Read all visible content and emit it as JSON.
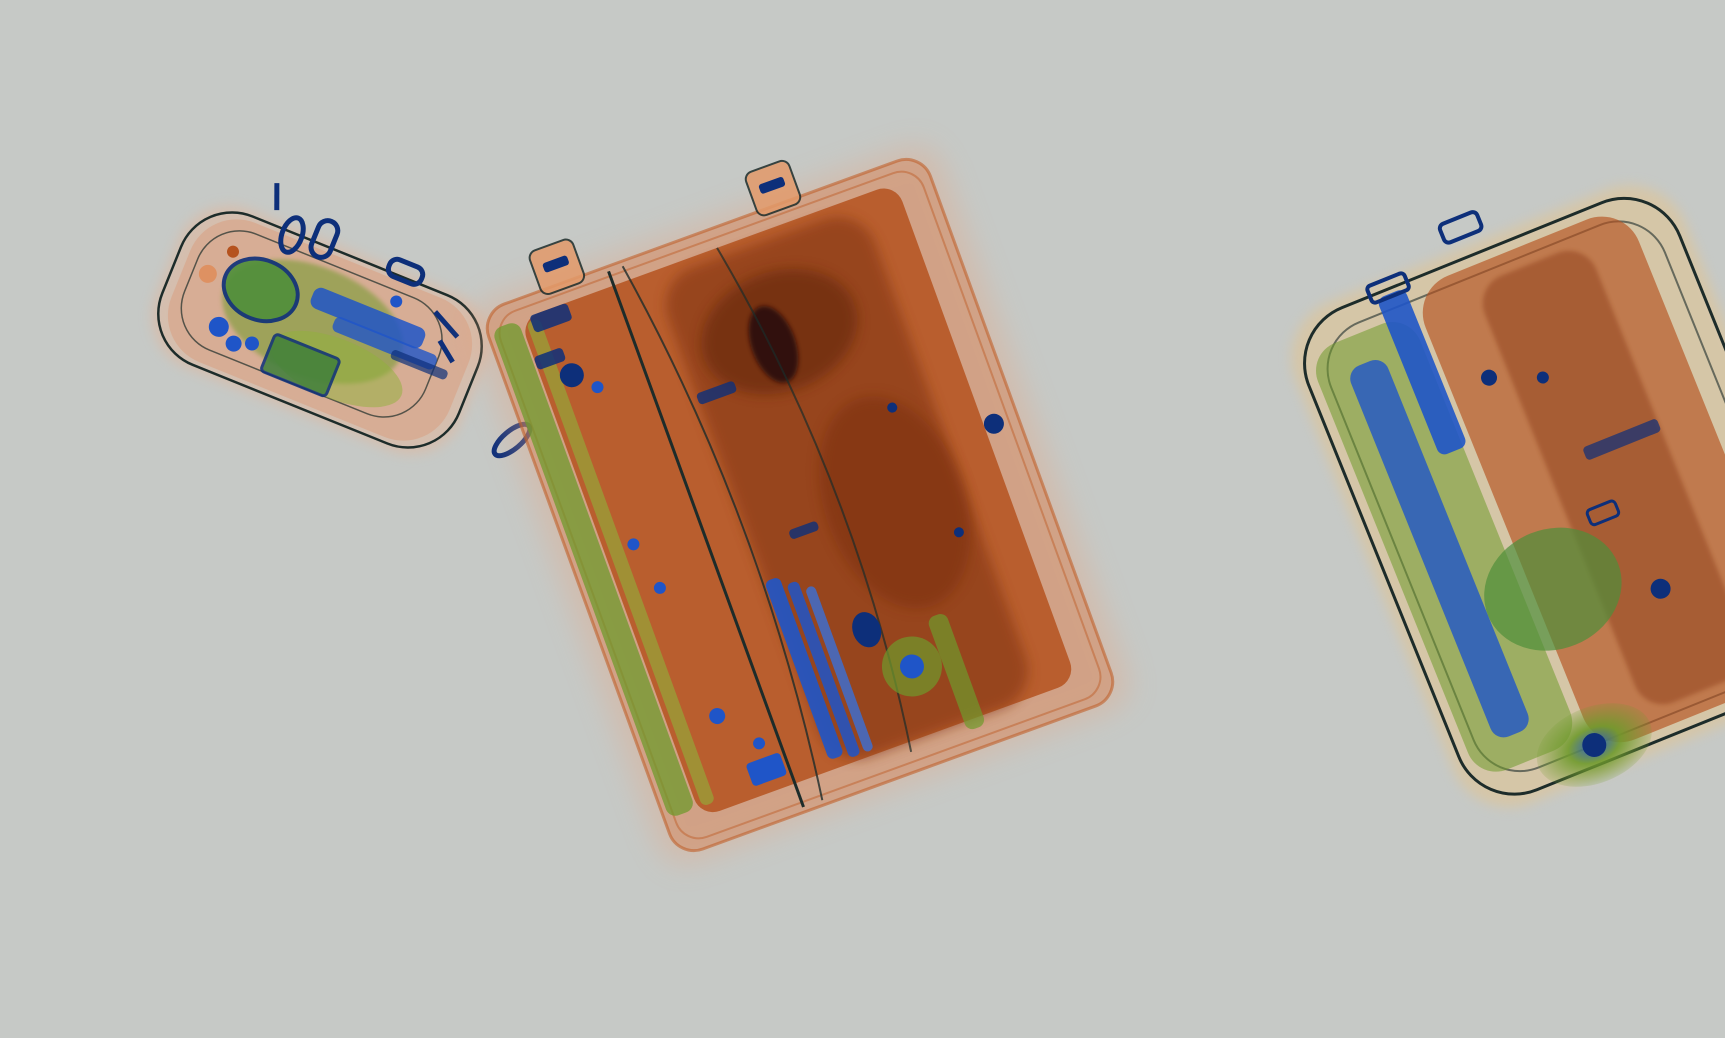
{
  "image": {
    "kind": "x-ray baggage scan",
    "background_color": "#c6c9c6",
    "palette": {
      "organic": "#b5521e",
      "organic_dark": "#7a2e10",
      "mixed": "#6f9a2c",
      "metal": "#1f55c8",
      "metal_dark": "#0d2f7a",
      "dense": "#2a0d0d",
      "outline": "#1d2c2a"
    }
  },
  "objects": [
    {
      "name": "small-bag",
      "material": "mixed"
    },
    {
      "name": "large-suitcase",
      "material": "organic"
    },
    {
      "name": "partial-suitcase",
      "material": "mixed"
    }
  ]
}
